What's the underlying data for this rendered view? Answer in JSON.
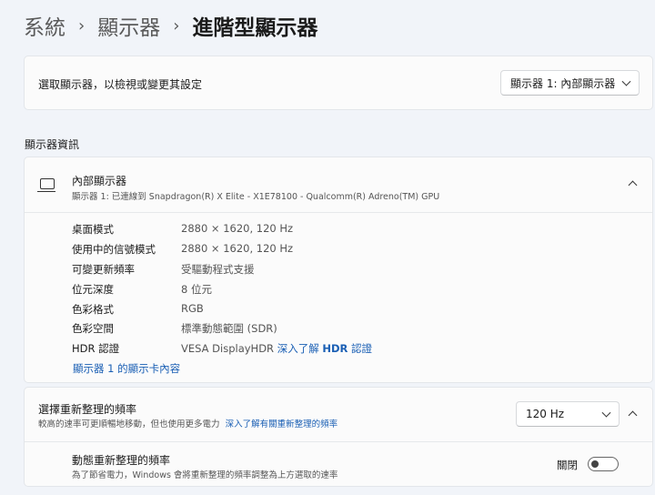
{
  "breadcrumb": {
    "level1": "系統",
    "level2": "顯示器",
    "current": "進階型顯示器",
    "separator": "›"
  },
  "display_select": {
    "label": "選取顯示器，以檢視或變更其設定",
    "selected": "顯示器 1: 內部顯示器"
  },
  "section_title": "顯示器資訊",
  "display_info": {
    "title": "內部顯示器",
    "subtitle": "顯示器 1: 已連線到 Snapdragon(R) X Elite - X1E78100 - Qualcomm(R) Adreno(TM) GPU",
    "rows": [
      {
        "key": "桌面模式",
        "value": "2880 × 1620, 120 Hz"
      },
      {
        "key": "使用中的信號模式",
        "value": "2880 × 1620, 120 Hz"
      },
      {
        "key": "可變更新頻率",
        "value": "受驅動程式支援"
      },
      {
        "key": "位元深度",
        "value": "8 位元"
      },
      {
        "key": "色彩格式",
        "value": "RGB"
      },
      {
        "key": "色彩空間",
        "value": "標準動態範圍 (SDR)"
      }
    ],
    "hdr": {
      "key": "HDR 認證",
      "value": "VESA DisplayHDR",
      "link_prefix": "深入了解 ",
      "link_bold": "HDR",
      "link_suffix": " 認證"
    },
    "adapter_link": "顯示器 1 的顯示卡內容"
  },
  "refresh_rate": {
    "title": "選擇重新整理的頻率",
    "description": "較高的速率可更順暢地移動，但也使用更多電力",
    "learn_more": "深入了解有關重新整理的頻率",
    "selected": "120 Hz",
    "dynamic": {
      "title": "動態重新整理的頻率",
      "description": "為了節省電力，Windows 會將重新整理的頻率調整為上方選取的速率",
      "toggle_label": "關閉",
      "toggle_on": false
    }
  },
  "colors": {
    "accent_link": "#1a5fb4",
    "page_background": "#f1f4f9",
    "card_background": "#fbfbfb"
  }
}
